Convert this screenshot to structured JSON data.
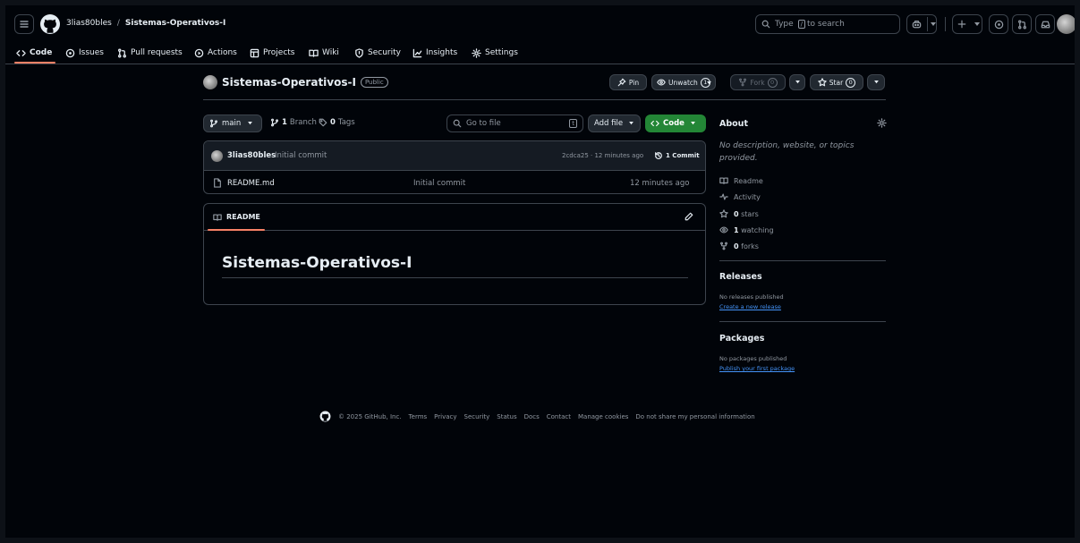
{
  "header": {
    "owner": "3lias80bles",
    "separator": "/",
    "repo": "Sistemas-Operativos-I",
    "search_prefix": "Type",
    "search_key": "/",
    "search_suffix": "to search"
  },
  "tabs": [
    {
      "label": "Code",
      "icon": "code-icon"
    },
    {
      "label": "Issues",
      "icon": "issue-icon"
    },
    {
      "label": "Pull requests",
      "icon": "pull-request-icon"
    },
    {
      "label": "Actions",
      "icon": "play-icon"
    },
    {
      "label": "Projects",
      "icon": "table-icon"
    },
    {
      "label": "Wiki",
      "icon": "book-icon"
    },
    {
      "label": "Security",
      "icon": "shield-icon"
    },
    {
      "label": "Insights",
      "icon": "graph-icon"
    },
    {
      "label": "Settings",
      "icon": "gear-icon"
    }
  ],
  "repo_header": {
    "name": "Sistemas-Operativos-I",
    "visibility": "Public",
    "pin_label": "Pin",
    "unwatch_label": "Unwatch",
    "unwatch_count": "1",
    "fork_label": "Fork",
    "fork_count": "0",
    "star_label": "Star",
    "star_count": "0"
  },
  "file_nav": {
    "branch": "main",
    "branch_count": "1",
    "branch_label": "Branch",
    "tag_count": "0",
    "tag_label": "Tags",
    "goto_placeholder": "Go to file",
    "goto_key": "t",
    "add_file_label": "Add file",
    "code_label": "Code"
  },
  "latest_commit": {
    "author": "3lias80bles",
    "message": "Initial commit",
    "meta": "2cdca25 · 12 minutes ago",
    "commit_count_label": "1 Commit"
  },
  "files": [
    {
      "name": "README.md",
      "message": "Initial commit",
      "age": "12 minutes ago"
    }
  ],
  "readme": {
    "tab_label": "README",
    "heading": "Sistemas-Operativos-I"
  },
  "sidebar": {
    "about_title": "About",
    "description": "No description, website, or topics provided.",
    "readme_label": "Readme",
    "activity_label": "Activity",
    "stars_count": "0",
    "stars_label": "stars",
    "watching_count": "1",
    "watching_label": "watching",
    "forks_count": "0",
    "forks_label": "forks",
    "releases_title": "Releases",
    "releases_none": "No releases published",
    "releases_link": "Create a new release",
    "packages_title": "Packages",
    "packages_none": "No packages published",
    "packages_link": "Publish your first package"
  },
  "footer": {
    "copyright": "© 2025 GitHub, Inc.",
    "links": [
      "Terms",
      "Privacy",
      "Security",
      "Status",
      "Docs",
      "Contact",
      "Manage cookies",
      "Do not share my personal information"
    ]
  },
  "colors": {
    "background": "#010409",
    "accent_tab": "#f78166",
    "code_button": "#238636",
    "link": "#4493f8",
    "border": "#3d444d"
  }
}
